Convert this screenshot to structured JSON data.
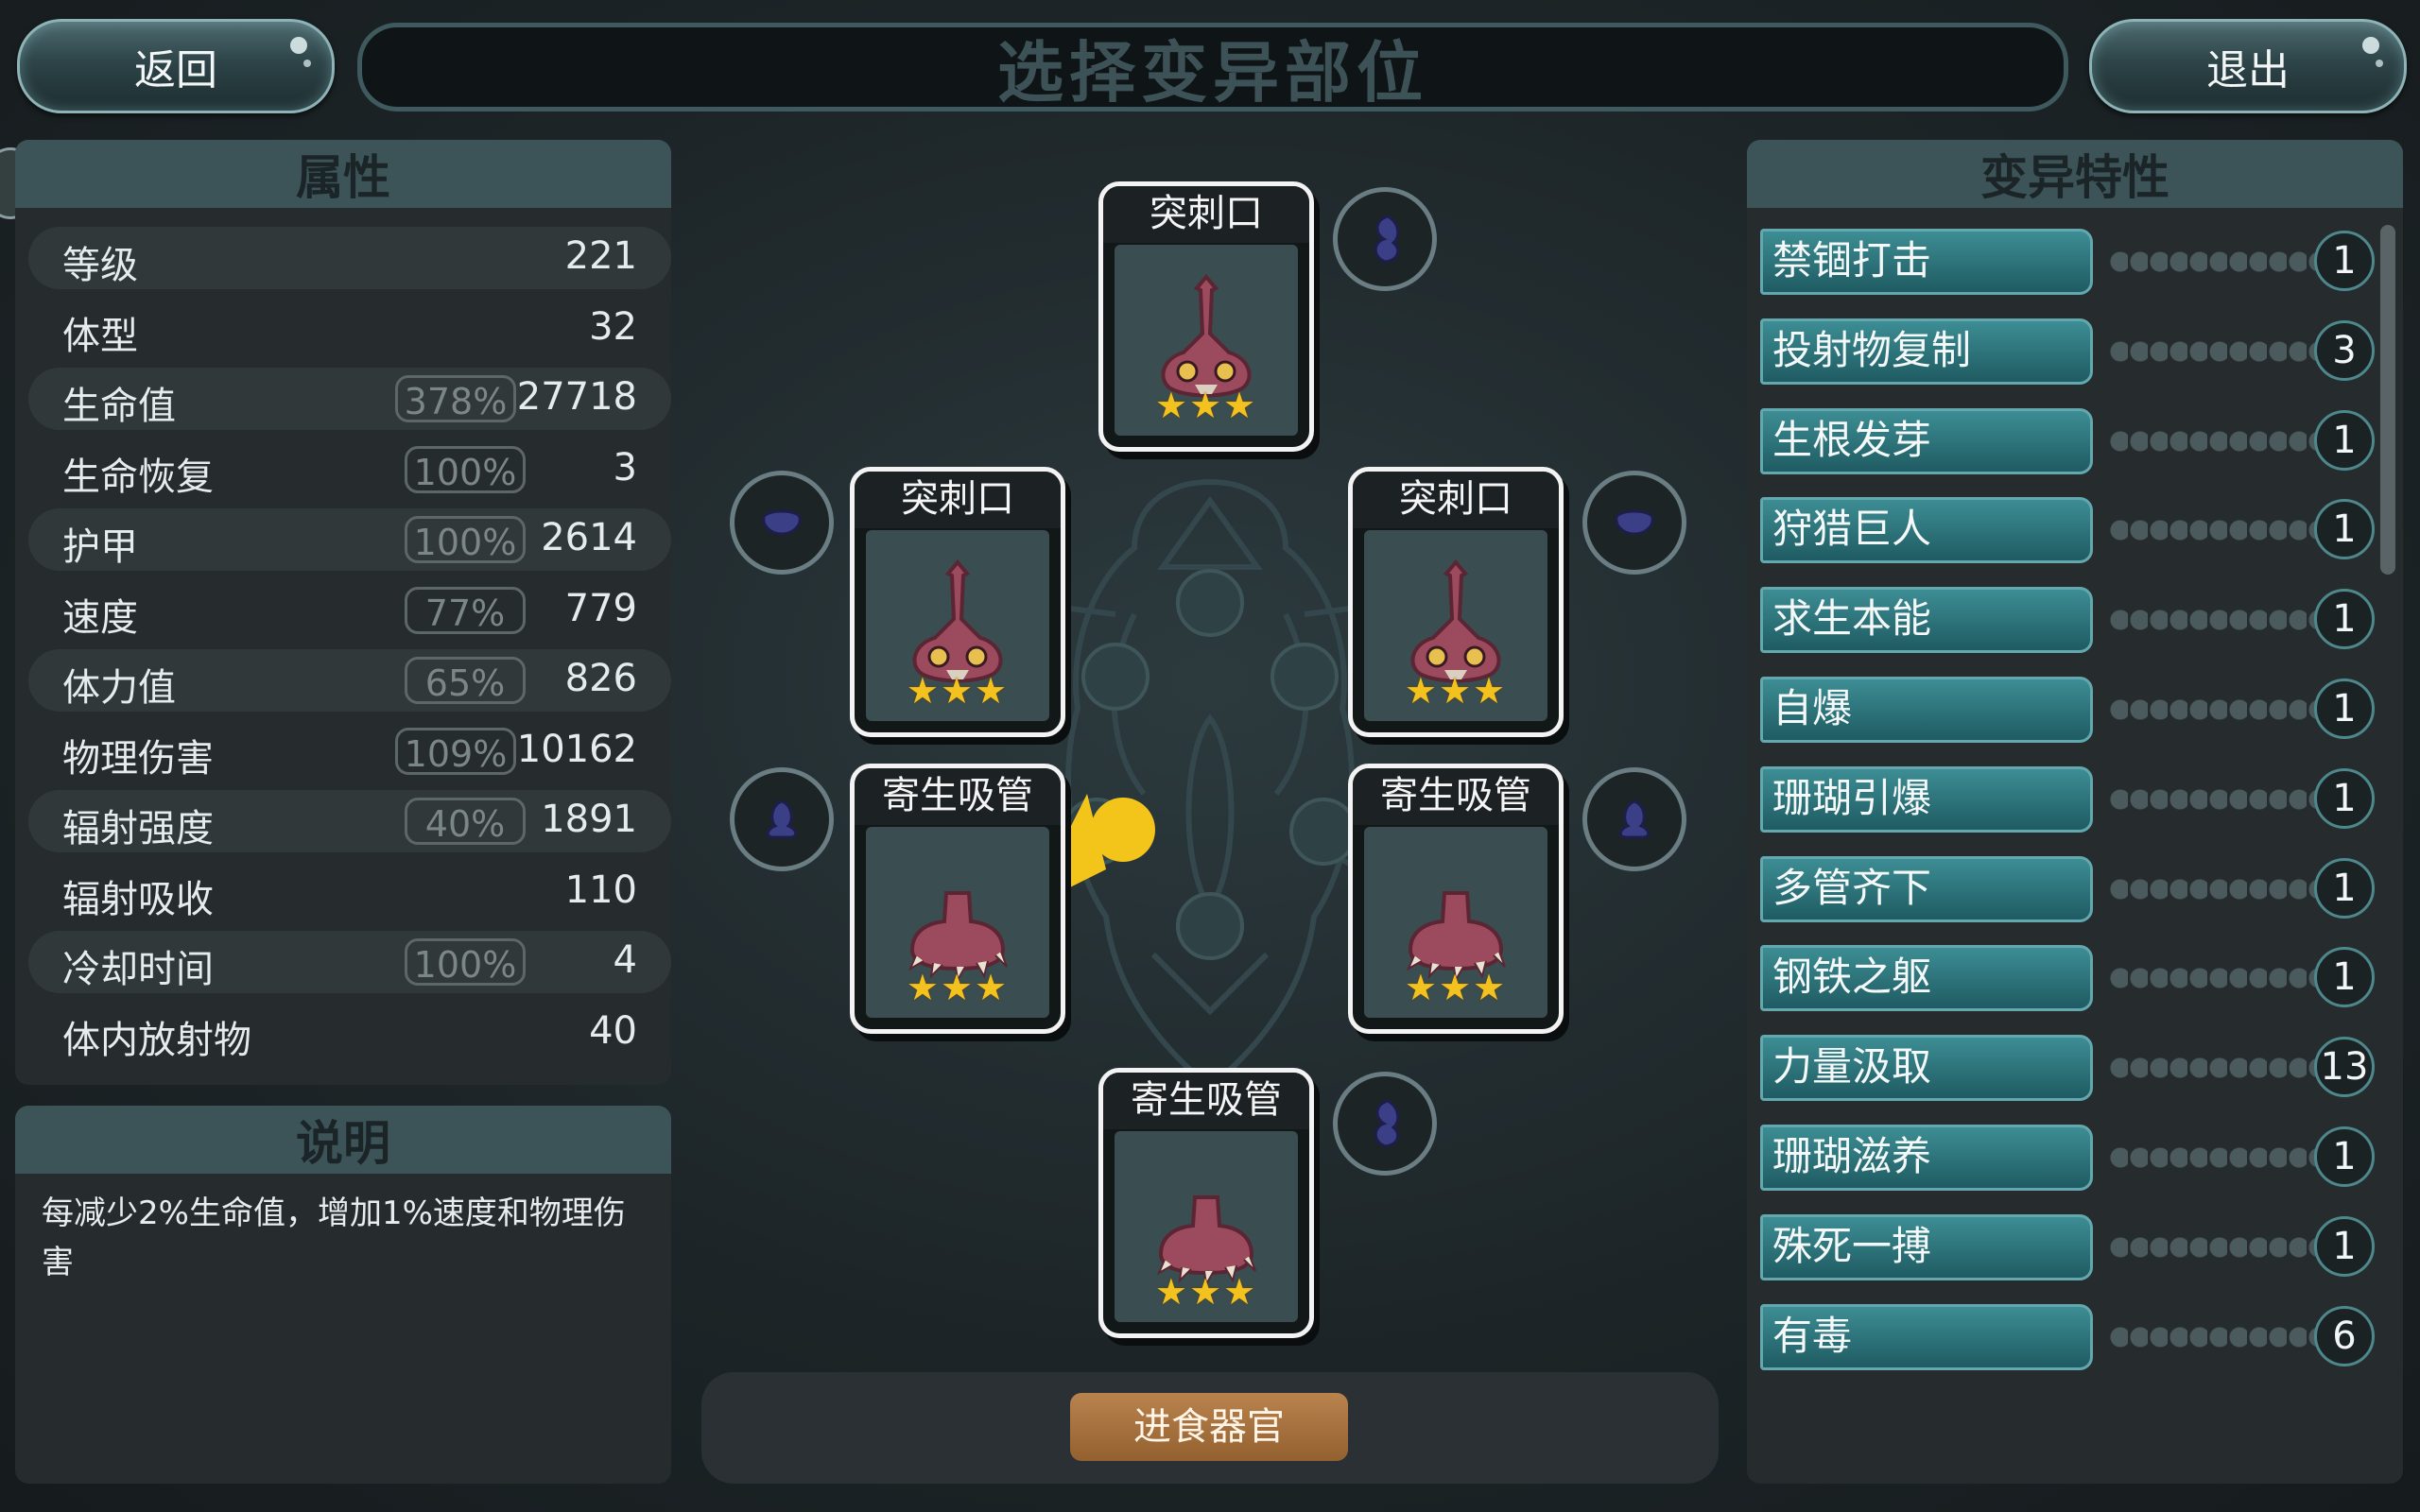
{
  "header": {
    "back_label": "返回",
    "title": "选择变异部位",
    "exit_label": "退出"
  },
  "attributes": {
    "title": "属性",
    "rows": [
      {
        "label": "等级",
        "pct": "",
        "value": "221"
      },
      {
        "label": "体型",
        "pct": "",
        "value": "32"
      },
      {
        "label": "生命值",
        "pct": "378%",
        "value": "27718"
      },
      {
        "label": "生命恢复",
        "pct": "100%",
        "value": "3"
      },
      {
        "label": "护甲",
        "pct": "100%",
        "value": "2614"
      },
      {
        "label": "速度",
        "pct": "77%",
        "value": "779"
      },
      {
        "label": "体力值",
        "pct": "65%",
        "value": "826"
      },
      {
        "label": "物理伤害",
        "pct": "109%",
        "value": "10162"
      },
      {
        "label": "辐射强度",
        "pct": "40%",
        "value": "1891"
      },
      {
        "label": "辐射吸收",
        "pct": "",
        "value": "110"
      },
      {
        "label": "冷却时间",
        "pct": "100%",
        "value": "4"
      },
      {
        "label": "体内放射物",
        "pct": "",
        "value": "40"
      }
    ]
  },
  "description": {
    "title": "说明",
    "text": "每减少2%生命值，增加1%速度和物理伤害"
  },
  "traits": {
    "title": "变异特性",
    "items": [
      {
        "name": "禁锢打击",
        "count": "1"
      },
      {
        "name": "投射物复制",
        "count": "3"
      },
      {
        "name": "生根发芽",
        "count": "1"
      },
      {
        "name": "狩猎巨人",
        "count": "1"
      },
      {
        "name": "求生本能",
        "count": "1"
      },
      {
        "name": "自爆",
        "count": "1"
      },
      {
        "name": "珊瑚引爆",
        "count": "1"
      },
      {
        "name": "多管齐下",
        "count": "1"
      },
      {
        "name": "钢铁之躯",
        "count": "1"
      },
      {
        "name": "力量汲取",
        "count": "13"
      },
      {
        "name": "珊瑚滋养",
        "count": "1"
      },
      {
        "name": "殊死一搏",
        "count": "1"
      },
      {
        "name": "有毒",
        "count": "6"
      }
    ]
  },
  "organs": {
    "top": {
      "name": "突刺口",
      "stars": "★★★",
      "kind": "spike-mouth-icon"
    },
    "mid_left": {
      "name": "突刺口",
      "stars": "★★★",
      "kind": "spike-mouth-icon"
    },
    "mid_right": {
      "name": "突刺口",
      "stars": "★★★",
      "kind": "spike-mouth-icon"
    },
    "low_left": {
      "name": "寄生吸管",
      "stars": "★★★",
      "kind": "parasite-tube-icon"
    },
    "low_right": {
      "name": "寄生吸管",
      "stars": "★★★",
      "kind": "parasite-tube-icon"
    },
    "bottom": {
      "name": "寄生吸管",
      "stars": "★★★",
      "kind": "parasite-tube-icon"
    }
  },
  "footer": {
    "category_label": "进食器官"
  },
  "colors": {
    "accent_teal": "#2f7a82",
    "star": "#f4c21f",
    "feed_button": "#a8743f",
    "card_border": "#f3f3f3"
  }
}
